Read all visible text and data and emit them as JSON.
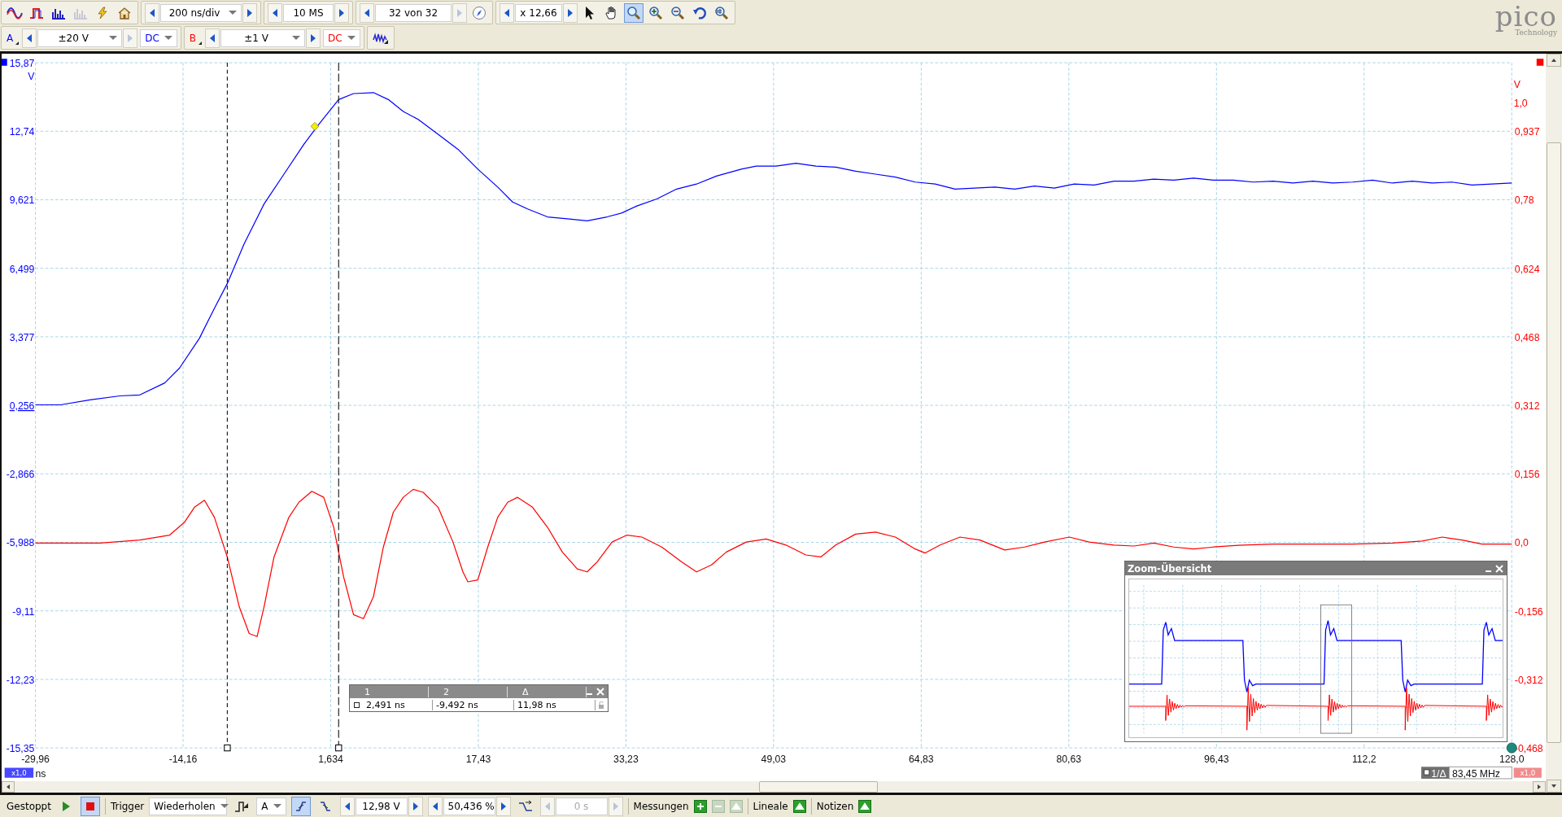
{
  "toolbar": {
    "view_buttons": [
      {
        "kind": "scope",
        "disabled": false
      },
      {
        "kind": "persistence",
        "disabled": false
      },
      {
        "kind": "spectrum",
        "disabled": false
      },
      {
        "kind": "spectrum",
        "disabled": true
      },
      {
        "kind": "lightning",
        "disabled": false
      },
      {
        "kind": "home",
        "disabled": false
      }
    ],
    "timebase": {
      "value": "200 ns/div",
      "dropdown": true,
      "prev_disabled": false,
      "next_disabled": false
    },
    "samples": {
      "value": "10 MS",
      "dropdown": false,
      "prev_disabled": false,
      "next_disabled": false
    },
    "buffer": {
      "value": "32 von 32",
      "dropdown": false,
      "prev_disabled": false,
      "next_disabled": true
    },
    "zoom": {
      "value": "x 12,66",
      "dropdown": false,
      "prev_disabled": false,
      "next_disabled": false
    },
    "tools": [
      {
        "kind": "pointer",
        "selected": false
      },
      {
        "kind": "hand",
        "selected": false
      },
      {
        "kind": "zoom",
        "selected": true
      },
      {
        "kind": "zoom_in",
        "selected": false
      },
      {
        "kind": "zoom_out",
        "selected": false
      },
      {
        "kind": "undo",
        "selected": false
      },
      {
        "kind": "zoom_fit",
        "selected": false
      }
    ]
  },
  "channels": [
    {
      "label": "A",
      "color": "#0000ff",
      "range": {
        "value": "±20 V",
        "dropdown": true,
        "prev_disabled": false,
        "next_disabled": true
      },
      "coupling": "DC"
    },
    {
      "label": "B",
      "color": "#ff0000",
      "range": {
        "value": "±1 V",
        "dropdown": true,
        "prev_disabled": false,
        "next_disabled": false
      },
      "coupling": "DC"
    }
  ],
  "logo": {
    "name": "pico",
    "tagline": "Technology"
  },
  "plot": {
    "left_axis": {
      "unit": "V",
      "ticks": [
        "15,87",
        "12,74",
        "9,621",
        "6,499",
        "3,377",
        "0,256",
        "-2,866",
        "-5,988",
        "-9,11",
        "-12,23",
        "-15,35"
      ]
    },
    "right_axis": {
      "unit": "V",
      "top_label": "1,0",
      "ticks": [
        "0,937",
        "0,78",
        "0,624",
        "0,468",
        "0,312",
        "0,156",
        "0,0",
        "-0,156",
        "-0,312",
        "-0,468"
      ]
    },
    "x_axis": {
      "unit": "ns",
      "ticks": [
        "-29,96",
        "-14,16",
        "1,634",
        "17,43",
        "33,23",
        "49,03",
        "64,83",
        "80,63",
        "96,43",
        "112,2",
        "128,0"
      ]
    },
    "left_zoom": "x1,0",
    "right_zoom": "x1,0",
    "frequency": {
      "label": "1/Δ",
      "value": "83,45 MHz"
    }
  },
  "rulers": {
    "headers": [
      "1",
      "2",
      "Δ"
    ],
    "values": [
      "2,491 ns",
      "-9,492 ns",
      "11,98 ns"
    ]
  },
  "zoom_overview": {
    "title": "Zoom-Übersicht"
  },
  "status_bar": {
    "state": "Gestoppt",
    "trigger_label": "Trigger",
    "trigger_mode": "Wiederholen",
    "trigger_source": "A",
    "edges": [
      {
        "kind": "rising",
        "selected": true
      },
      {
        "kind": "falling",
        "selected": false
      }
    ],
    "threshold": {
      "value": "12,98 V",
      "dropdown": false,
      "prev_disabled": false,
      "next_disabled": false
    },
    "pretrigger": {
      "value": "50,436 %",
      "dropdown": false,
      "prev_disabled": false,
      "next_disabled": false
    },
    "delay": {
      "value": "0 s",
      "dropdown": false,
      "prev_disabled": true,
      "next_disabled": true
    },
    "sections": [
      {
        "label": "Messungen",
        "buttons": [
          {
            "kind": "add",
            "disabled": false
          },
          {
            "kind": "remove",
            "disabled": true
          },
          {
            "kind": "edit",
            "disabled": true
          }
        ]
      },
      {
        "label": "Lineale",
        "buttons": [
          {
            "kind": "expand",
            "disabled": false
          }
        ]
      },
      {
        "label": "Notizen",
        "buttons": [
          {
            "kind": "expand",
            "disabled": false
          }
        ]
      }
    ]
  }
}
